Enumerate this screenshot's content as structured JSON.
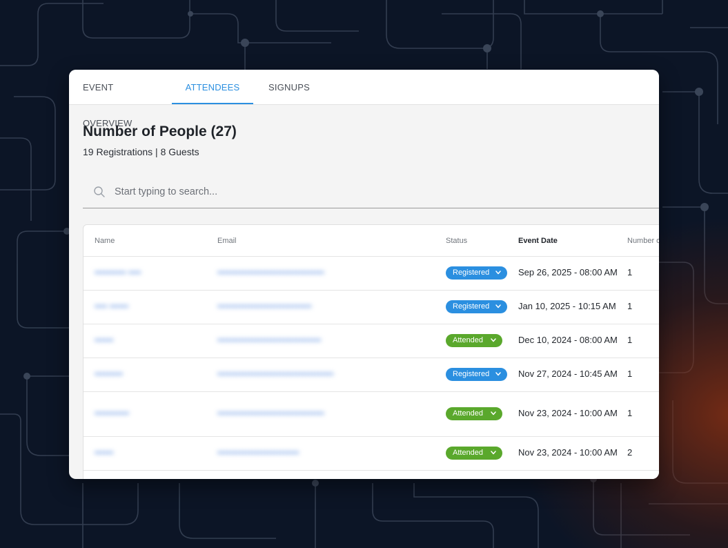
{
  "tabs": [
    {
      "label": "EVENT OVERVIEW"
    },
    {
      "label": "ATTENDEES",
      "active": true
    },
    {
      "label": "SIGNUPS"
    }
  ],
  "summary": {
    "title": "Number of People (27)",
    "subtitle": "19 Registrations | 8 Guests"
  },
  "search": {
    "placeholder": "Start typing to search...",
    "icon": "search-icon"
  },
  "table": {
    "headers": {
      "name": "Name",
      "email": "Email",
      "status": "Status",
      "event_date": "Event Date",
      "number": "Number o"
    },
    "rows": [
      {
        "name": "•••••••••• ••••",
        "email": "••••••••••••••••••••••••••••••••••",
        "status": "Registered",
        "status_type": "registered",
        "date": "Sep 26, 2025 - 08:00 AM",
        "count": "1"
      },
      {
        "name": "•••• ••••••",
        "email": "••••••••••••••••••••••••••••••",
        "status": "Registered",
        "status_type": "registered",
        "date": "Jan 10, 2025 - 10:15 AM",
        "count": "1"
      },
      {
        "name": "••••••",
        "email": "•••••••••••••••••••••••••••••••••",
        "status": "Attended",
        "status_type": "attended",
        "date": "Dec 10, 2024 - 08:00 AM",
        "count": "1"
      },
      {
        "name": "•••••••••",
        "email": "•••••••••••••••••••••••••••••••••••••",
        "status": "Registered",
        "status_type": "registered",
        "date": "Nov 27, 2024 - 10:45 AM",
        "count": "1"
      },
      {
        "name": "•••••••••••",
        "email": "••••••••••••••••••••••••••••••••••",
        "status": "Attended",
        "status_type": "attended",
        "date": "Nov 23, 2024 - 10:00 AM",
        "count": "1"
      },
      {
        "name": "••••••",
        "email": "••••••••••••••••••••••••••",
        "status": "Attended",
        "status_type": "attended",
        "date": "Nov 23, 2024 - 10:00 AM",
        "count": "2"
      }
    ]
  },
  "colors": {
    "accent": "#2b8fe0",
    "registered": "#2b8fe0",
    "attended": "#5aa82c",
    "background": "#0c1526"
  }
}
